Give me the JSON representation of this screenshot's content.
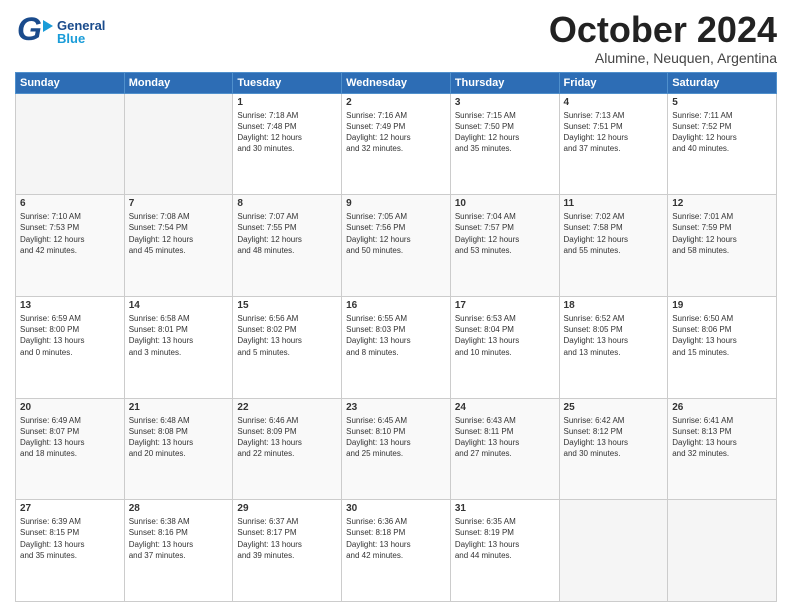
{
  "header": {
    "logo_general": "General",
    "logo_blue": "Blue",
    "month_title": "October 2024",
    "subtitle": "Alumine, Neuquen, Argentina"
  },
  "weekdays": [
    "Sunday",
    "Monday",
    "Tuesday",
    "Wednesday",
    "Thursday",
    "Friday",
    "Saturday"
  ],
  "rows": [
    [
      {
        "day": "",
        "text": ""
      },
      {
        "day": "",
        "text": ""
      },
      {
        "day": "1",
        "text": "Sunrise: 7:18 AM\nSunset: 7:48 PM\nDaylight: 12 hours\nand 30 minutes."
      },
      {
        "day": "2",
        "text": "Sunrise: 7:16 AM\nSunset: 7:49 PM\nDaylight: 12 hours\nand 32 minutes."
      },
      {
        "day": "3",
        "text": "Sunrise: 7:15 AM\nSunset: 7:50 PM\nDaylight: 12 hours\nand 35 minutes."
      },
      {
        "day": "4",
        "text": "Sunrise: 7:13 AM\nSunset: 7:51 PM\nDaylight: 12 hours\nand 37 minutes."
      },
      {
        "day": "5",
        "text": "Sunrise: 7:11 AM\nSunset: 7:52 PM\nDaylight: 12 hours\nand 40 minutes."
      }
    ],
    [
      {
        "day": "6",
        "text": "Sunrise: 7:10 AM\nSunset: 7:53 PM\nDaylight: 12 hours\nand 42 minutes."
      },
      {
        "day": "7",
        "text": "Sunrise: 7:08 AM\nSunset: 7:54 PM\nDaylight: 12 hours\nand 45 minutes."
      },
      {
        "day": "8",
        "text": "Sunrise: 7:07 AM\nSunset: 7:55 PM\nDaylight: 12 hours\nand 48 minutes."
      },
      {
        "day": "9",
        "text": "Sunrise: 7:05 AM\nSunset: 7:56 PM\nDaylight: 12 hours\nand 50 minutes."
      },
      {
        "day": "10",
        "text": "Sunrise: 7:04 AM\nSunset: 7:57 PM\nDaylight: 12 hours\nand 53 minutes."
      },
      {
        "day": "11",
        "text": "Sunrise: 7:02 AM\nSunset: 7:58 PM\nDaylight: 12 hours\nand 55 minutes."
      },
      {
        "day": "12",
        "text": "Sunrise: 7:01 AM\nSunset: 7:59 PM\nDaylight: 12 hours\nand 58 minutes."
      }
    ],
    [
      {
        "day": "13",
        "text": "Sunrise: 6:59 AM\nSunset: 8:00 PM\nDaylight: 13 hours\nand 0 minutes."
      },
      {
        "day": "14",
        "text": "Sunrise: 6:58 AM\nSunset: 8:01 PM\nDaylight: 13 hours\nand 3 minutes."
      },
      {
        "day": "15",
        "text": "Sunrise: 6:56 AM\nSunset: 8:02 PM\nDaylight: 13 hours\nand 5 minutes."
      },
      {
        "day": "16",
        "text": "Sunrise: 6:55 AM\nSunset: 8:03 PM\nDaylight: 13 hours\nand 8 minutes."
      },
      {
        "day": "17",
        "text": "Sunrise: 6:53 AM\nSunset: 8:04 PM\nDaylight: 13 hours\nand 10 minutes."
      },
      {
        "day": "18",
        "text": "Sunrise: 6:52 AM\nSunset: 8:05 PM\nDaylight: 13 hours\nand 13 minutes."
      },
      {
        "day": "19",
        "text": "Sunrise: 6:50 AM\nSunset: 8:06 PM\nDaylight: 13 hours\nand 15 minutes."
      }
    ],
    [
      {
        "day": "20",
        "text": "Sunrise: 6:49 AM\nSunset: 8:07 PM\nDaylight: 13 hours\nand 18 minutes."
      },
      {
        "day": "21",
        "text": "Sunrise: 6:48 AM\nSunset: 8:08 PM\nDaylight: 13 hours\nand 20 minutes."
      },
      {
        "day": "22",
        "text": "Sunrise: 6:46 AM\nSunset: 8:09 PM\nDaylight: 13 hours\nand 22 minutes."
      },
      {
        "day": "23",
        "text": "Sunrise: 6:45 AM\nSunset: 8:10 PM\nDaylight: 13 hours\nand 25 minutes."
      },
      {
        "day": "24",
        "text": "Sunrise: 6:43 AM\nSunset: 8:11 PM\nDaylight: 13 hours\nand 27 minutes."
      },
      {
        "day": "25",
        "text": "Sunrise: 6:42 AM\nSunset: 8:12 PM\nDaylight: 13 hours\nand 30 minutes."
      },
      {
        "day": "26",
        "text": "Sunrise: 6:41 AM\nSunset: 8:13 PM\nDaylight: 13 hours\nand 32 minutes."
      }
    ],
    [
      {
        "day": "27",
        "text": "Sunrise: 6:39 AM\nSunset: 8:15 PM\nDaylight: 13 hours\nand 35 minutes."
      },
      {
        "day": "28",
        "text": "Sunrise: 6:38 AM\nSunset: 8:16 PM\nDaylight: 13 hours\nand 37 minutes."
      },
      {
        "day": "29",
        "text": "Sunrise: 6:37 AM\nSunset: 8:17 PM\nDaylight: 13 hours\nand 39 minutes."
      },
      {
        "day": "30",
        "text": "Sunrise: 6:36 AM\nSunset: 8:18 PM\nDaylight: 13 hours\nand 42 minutes."
      },
      {
        "day": "31",
        "text": "Sunrise: 6:35 AM\nSunset: 8:19 PM\nDaylight: 13 hours\nand 44 minutes."
      },
      {
        "day": "",
        "text": ""
      },
      {
        "day": "",
        "text": ""
      }
    ]
  ]
}
